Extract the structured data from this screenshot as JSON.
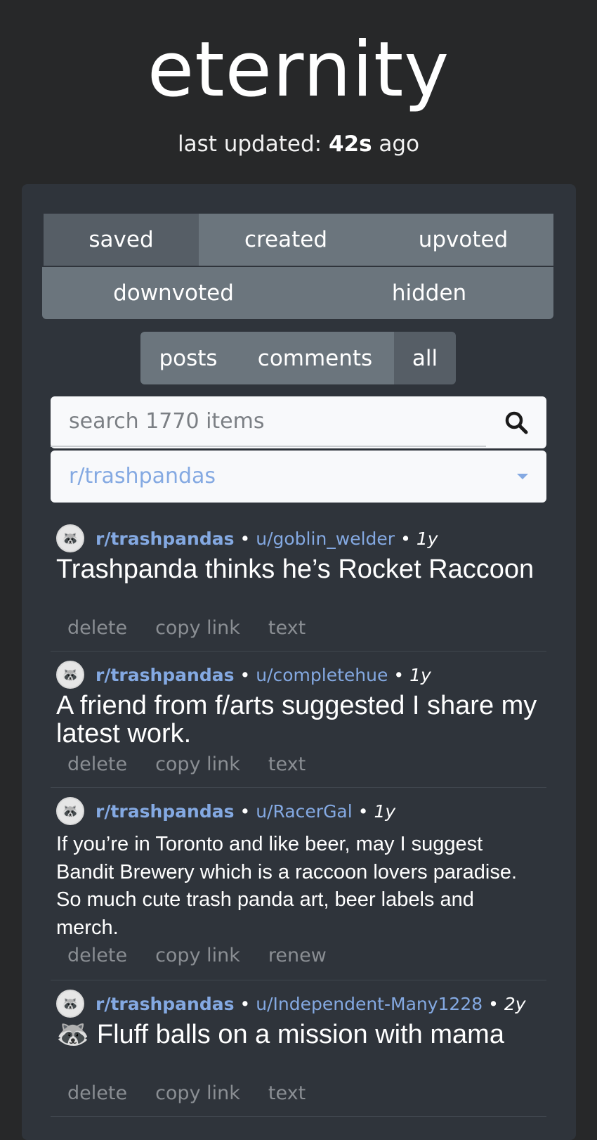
{
  "app": {
    "title": "eternity"
  },
  "status": {
    "prefix": "last updated:",
    "value": "42s",
    "suffix": "ago"
  },
  "category_tabs": [
    "saved",
    "created",
    "upvoted",
    "downvoted",
    "hidden"
  ],
  "type_filter": [
    "posts",
    "comments",
    "all"
  ],
  "search": {
    "placeholder": "search 1770 items",
    "value": ""
  },
  "subreddit_filter": {
    "value": "r/trashpandas"
  },
  "items": [
    {
      "subreddit": "r/trashpandas",
      "user": "u/goblin_welder",
      "age": "1y",
      "title": "Trashpanda thinks he’s Rocket Raccoon",
      "actions": [
        "delete",
        "copy link",
        "text"
      ]
    },
    {
      "subreddit": "r/trashpandas",
      "user": "u/completehue",
      "age": "1y",
      "title": "A friend from f/arts suggested I share my latest work.",
      "actions": [
        "delete",
        "copy link",
        "text"
      ]
    },
    {
      "subreddit": "r/trashpandas",
      "user": "u/RacerGal",
      "age": "1y",
      "body": "If you’re in Toronto and like beer, may I suggest Bandit Brewery which is a raccoon lovers paradise. So much cute trash panda art, beer labels and merch.",
      "actions": [
        "delete",
        "copy link",
        "renew"
      ]
    },
    {
      "subreddit": "r/trashpandas",
      "user": "u/Independent-Many1228",
      "age": "2y",
      "title": "🦝 Fluff balls on a mission with mama",
      "actions": [
        "delete",
        "copy link",
        "text"
      ]
    }
  ],
  "separator": "•",
  "avatar_glyph": "🦝",
  "colors": {
    "background": "#272829",
    "panel": "#2f343b",
    "tab": "#6b757d",
    "tab_active": "#565e66",
    "link": "#84a9e2",
    "muted": "#8a8e93"
  }
}
